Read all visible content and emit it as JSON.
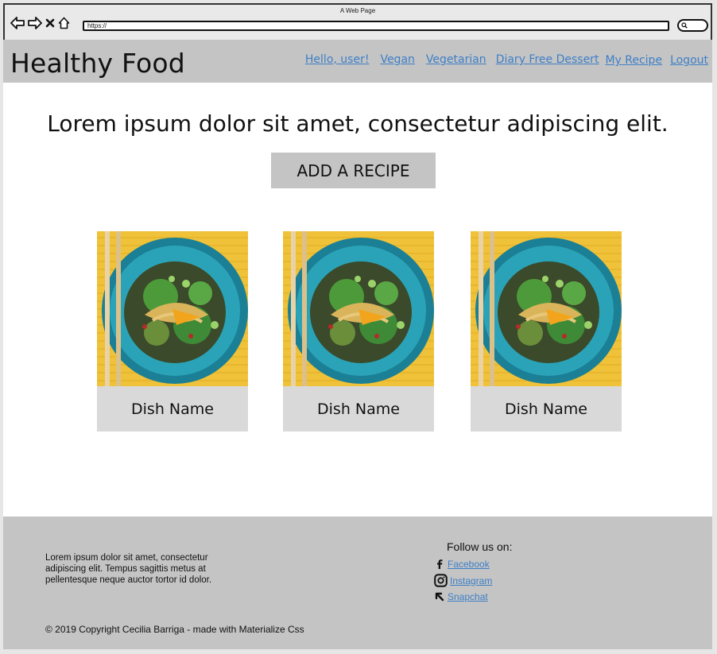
{
  "window": {
    "title": "A Web Page",
    "url": "https://"
  },
  "header": {
    "brand": "Healthy Food",
    "nav": [
      "Hello, user!",
      "Vegan",
      "Vegetarian",
      "Diary Free Dessert",
      "My Recipe",
      "Logout"
    ]
  },
  "main": {
    "headline": "Lorem ipsum dolor sit amet, consectetur adipiscing elit.",
    "add_button": "ADD A RECIPE",
    "cards": [
      {
        "name": "Dish Name"
      },
      {
        "name": "Dish Name"
      },
      {
        "name": "Dish Name"
      }
    ]
  },
  "footer": {
    "about": "Lorem ipsum dolor sit amet, consectetur adipiscing elit. Tempus sagittis metus at pellentesque neque auctor tortor id dolor.",
    "follow_label": "Follow us on:",
    "social": [
      {
        "label": "Facebook",
        "icon": "facebook-icon"
      },
      {
        "label": "Instagram",
        "icon": "instagram-icon"
      },
      {
        "label": "Snapchat",
        "icon": "snapchat-icon"
      }
    ],
    "copyright": "© 2019 Copyright Cecilia Barriga - made with Materialize Css"
  },
  "colors": {
    "nav_bg": "#c4c4c4",
    "link": "#3d7fc7",
    "card_caption_bg": "#d9d9d9"
  }
}
